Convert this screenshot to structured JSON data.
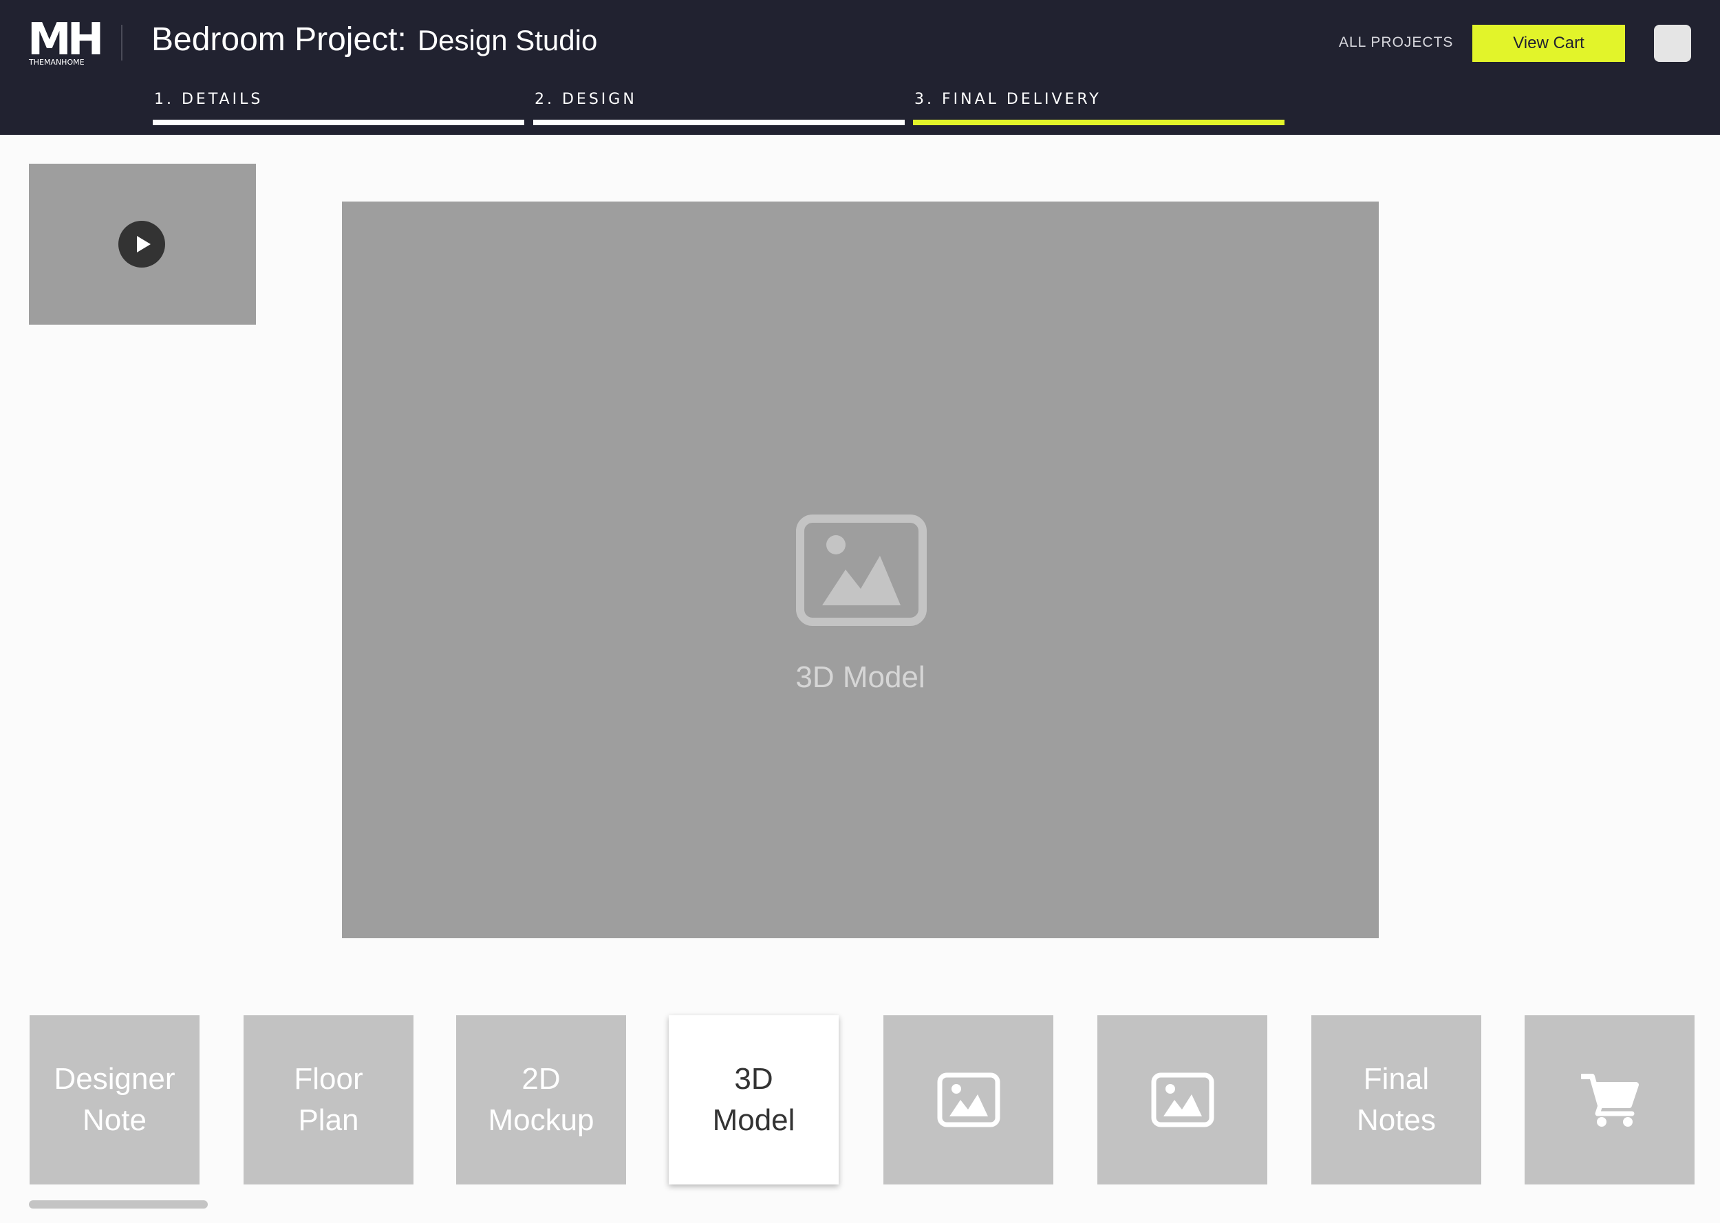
{
  "brand": {
    "mark": "MH",
    "name": "THEMANHOME"
  },
  "header": {
    "title": "Bedroom Project:",
    "subtitle": "Design Studio",
    "all_projects_label": "ALL PROJECTS",
    "view_cart_label": "View Cart"
  },
  "steps": [
    {
      "label": "1. DETAILS",
      "active": false
    },
    {
      "label": "2. DESIGN",
      "active": false
    },
    {
      "label": "3. FINAL DELIVERY",
      "active": true
    }
  ],
  "video": {
    "icon": "play-icon"
  },
  "preview": {
    "icon": "image-icon",
    "label": "3D Model"
  },
  "tiles": [
    {
      "label": "Designer\nNote",
      "active": false
    },
    {
      "label": "Floor\nPlan",
      "active": false
    },
    {
      "label": "2D\nMockup",
      "active": false
    },
    {
      "label": "3D\nModel",
      "active": true
    },
    {
      "icon": "image-icon",
      "active": false
    },
    {
      "icon": "image-icon",
      "active": false
    },
    {
      "label": "Final\nNotes",
      "active": false
    },
    {
      "icon": "cart-icon",
      "active": false
    }
  ],
  "colors": {
    "header_bg": "#212230",
    "accent": "#e2f42a",
    "placeholder_gray": "#9e9e9e",
    "tile_gray": "#c2c2c2"
  }
}
